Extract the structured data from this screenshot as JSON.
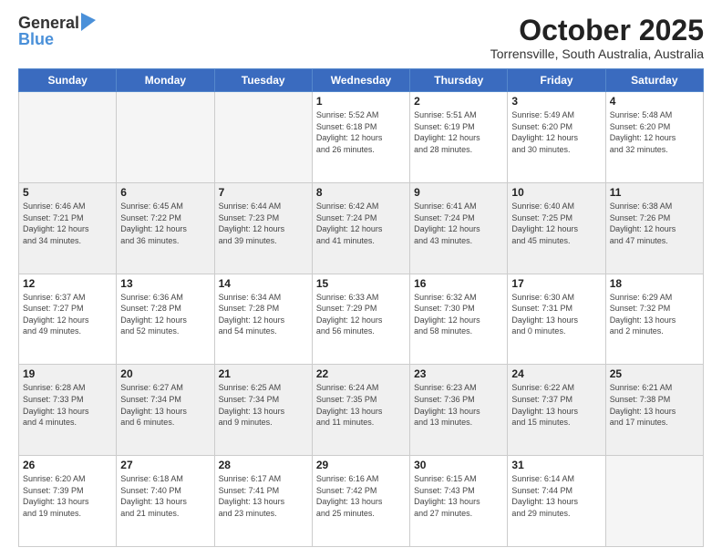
{
  "logo": {
    "general": "General",
    "blue": "Blue"
  },
  "header": {
    "month": "October 2025",
    "location": "Torrensville, South Australia, Australia"
  },
  "days_of_week": [
    "Sunday",
    "Monday",
    "Tuesday",
    "Wednesday",
    "Thursday",
    "Friday",
    "Saturday"
  ],
  "weeks": [
    [
      {
        "day": "",
        "info": ""
      },
      {
        "day": "",
        "info": ""
      },
      {
        "day": "",
        "info": ""
      },
      {
        "day": "1",
        "info": "Sunrise: 5:52 AM\nSunset: 6:18 PM\nDaylight: 12 hours\nand 26 minutes."
      },
      {
        "day": "2",
        "info": "Sunrise: 5:51 AM\nSunset: 6:19 PM\nDaylight: 12 hours\nand 28 minutes."
      },
      {
        "day": "3",
        "info": "Sunrise: 5:49 AM\nSunset: 6:20 PM\nDaylight: 12 hours\nand 30 minutes."
      },
      {
        "day": "4",
        "info": "Sunrise: 5:48 AM\nSunset: 6:20 PM\nDaylight: 12 hours\nand 32 minutes."
      }
    ],
    [
      {
        "day": "5",
        "info": "Sunrise: 6:46 AM\nSunset: 7:21 PM\nDaylight: 12 hours\nand 34 minutes."
      },
      {
        "day": "6",
        "info": "Sunrise: 6:45 AM\nSunset: 7:22 PM\nDaylight: 12 hours\nand 36 minutes."
      },
      {
        "day": "7",
        "info": "Sunrise: 6:44 AM\nSunset: 7:23 PM\nDaylight: 12 hours\nand 39 minutes."
      },
      {
        "day": "8",
        "info": "Sunrise: 6:42 AM\nSunset: 7:24 PM\nDaylight: 12 hours\nand 41 minutes."
      },
      {
        "day": "9",
        "info": "Sunrise: 6:41 AM\nSunset: 7:24 PM\nDaylight: 12 hours\nand 43 minutes."
      },
      {
        "day": "10",
        "info": "Sunrise: 6:40 AM\nSunset: 7:25 PM\nDaylight: 12 hours\nand 45 minutes."
      },
      {
        "day": "11",
        "info": "Sunrise: 6:38 AM\nSunset: 7:26 PM\nDaylight: 12 hours\nand 47 minutes."
      }
    ],
    [
      {
        "day": "12",
        "info": "Sunrise: 6:37 AM\nSunset: 7:27 PM\nDaylight: 12 hours\nand 49 minutes."
      },
      {
        "day": "13",
        "info": "Sunrise: 6:36 AM\nSunset: 7:28 PM\nDaylight: 12 hours\nand 52 minutes."
      },
      {
        "day": "14",
        "info": "Sunrise: 6:34 AM\nSunset: 7:28 PM\nDaylight: 12 hours\nand 54 minutes."
      },
      {
        "day": "15",
        "info": "Sunrise: 6:33 AM\nSunset: 7:29 PM\nDaylight: 12 hours\nand 56 minutes."
      },
      {
        "day": "16",
        "info": "Sunrise: 6:32 AM\nSunset: 7:30 PM\nDaylight: 12 hours\nand 58 minutes."
      },
      {
        "day": "17",
        "info": "Sunrise: 6:30 AM\nSunset: 7:31 PM\nDaylight: 13 hours\nand 0 minutes."
      },
      {
        "day": "18",
        "info": "Sunrise: 6:29 AM\nSunset: 7:32 PM\nDaylight: 13 hours\nand 2 minutes."
      }
    ],
    [
      {
        "day": "19",
        "info": "Sunrise: 6:28 AM\nSunset: 7:33 PM\nDaylight: 13 hours\nand 4 minutes."
      },
      {
        "day": "20",
        "info": "Sunrise: 6:27 AM\nSunset: 7:34 PM\nDaylight: 13 hours\nand 6 minutes."
      },
      {
        "day": "21",
        "info": "Sunrise: 6:25 AM\nSunset: 7:34 PM\nDaylight: 13 hours\nand 9 minutes."
      },
      {
        "day": "22",
        "info": "Sunrise: 6:24 AM\nSunset: 7:35 PM\nDaylight: 13 hours\nand 11 minutes."
      },
      {
        "day": "23",
        "info": "Sunrise: 6:23 AM\nSunset: 7:36 PM\nDaylight: 13 hours\nand 13 minutes."
      },
      {
        "day": "24",
        "info": "Sunrise: 6:22 AM\nSunset: 7:37 PM\nDaylight: 13 hours\nand 15 minutes."
      },
      {
        "day": "25",
        "info": "Sunrise: 6:21 AM\nSunset: 7:38 PM\nDaylight: 13 hours\nand 17 minutes."
      }
    ],
    [
      {
        "day": "26",
        "info": "Sunrise: 6:20 AM\nSunset: 7:39 PM\nDaylight: 13 hours\nand 19 minutes."
      },
      {
        "day": "27",
        "info": "Sunrise: 6:18 AM\nSunset: 7:40 PM\nDaylight: 13 hours\nand 21 minutes."
      },
      {
        "day": "28",
        "info": "Sunrise: 6:17 AM\nSunset: 7:41 PM\nDaylight: 13 hours\nand 23 minutes."
      },
      {
        "day": "29",
        "info": "Sunrise: 6:16 AM\nSunset: 7:42 PM\nDaylight: 13 hours\nand 25 minutes."
      },
      {
        "day": "30",
        "info": "Sunrise: 6:15 AM\nSunset: 7:43 PM\nDaylight: 13 hours\nand 27 minutes."
      },
      {
        "day": "31",
        "info": "Sunrise: 6:14 AM\nSunset: 7:44 PM\nDaylight: 13 hours\nand 29 minutes."
      },
      {
        "day": "",
        "info": ""
      }
    ]
  ]
}
